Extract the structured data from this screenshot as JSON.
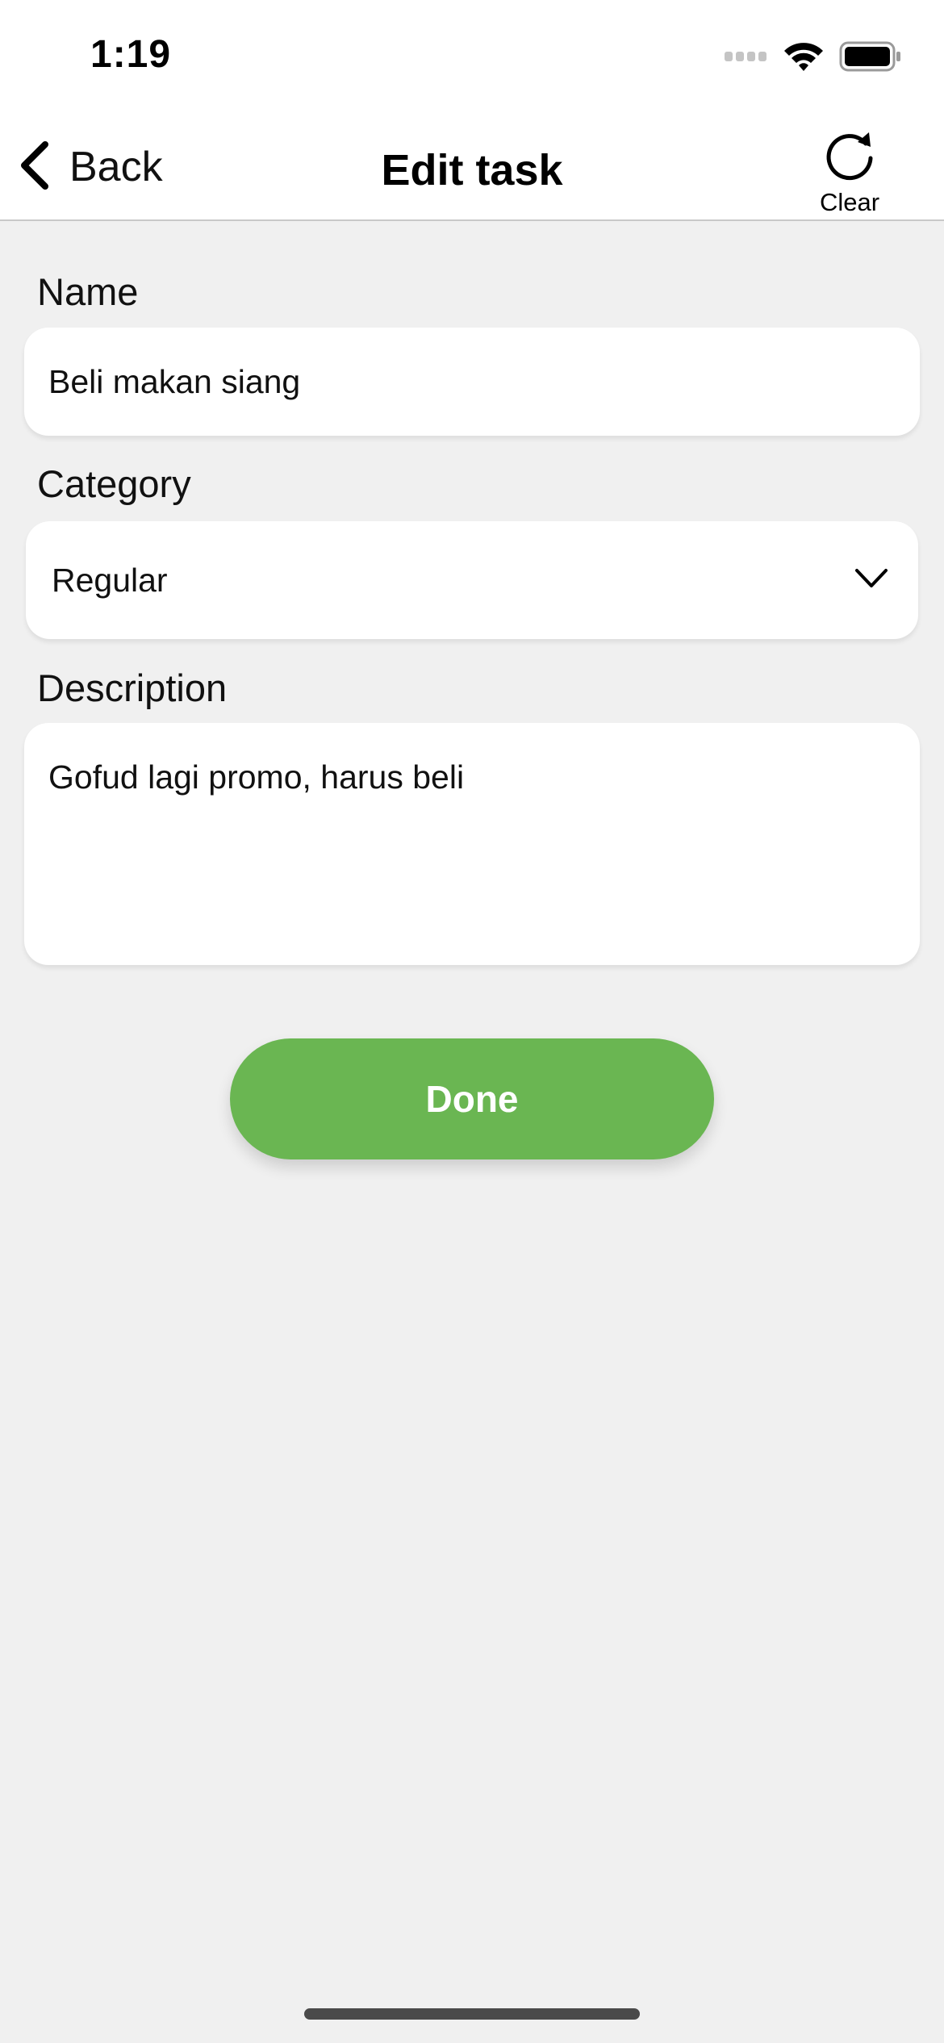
{
  "status_bar": {
    "time": "1:19",
    "icons": [
      "cellular-signal-icon",
      "wifi-icon",
      "battery-icon"
    ]
  },
  "nav": {
    "back_label": "Back",
    "title": "Edit task",
    "clear_label": "Clear",
    "icons": [
      "chevron-left-icon",
      "refresh-icon"
    ]
  },
  "form": {
    "name": {
      "label": "Name",
      "value": "Beli makan siang"
    },
    "category": {
      "label": "Category",
      "selected": "Regular",
      "icon": "chevron-down-icon"
    },
    "description": {
      "label": "Description",
      "value": "Gofud lagi promo, harus beli"
    }
  },
  "actions": {
    "done_label": "Done"
  },
  "colors": {
    "background": "#f0f0f0",
    "surface": "#ffffff",
    "accent": "#6ab652",
    "divider": "#c8c8c8"
  }
}
